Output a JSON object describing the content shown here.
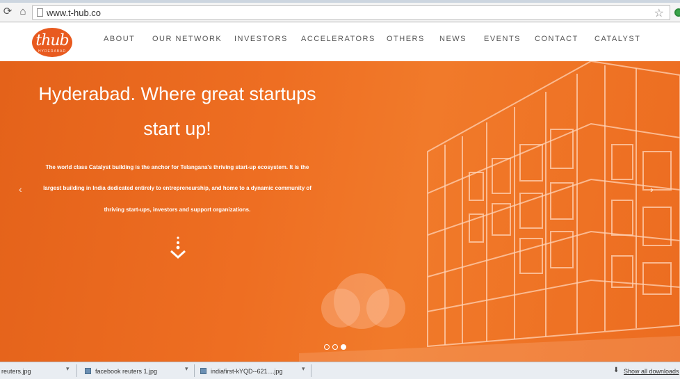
{
  "browser": {
    "url": "www.t-hub.co",
    "back_icon": "reload-icon",
    "home_icon": "home-icon"
  },
  "header": {
    "logo_text": "thub",
    "logo_sub": "HYDERABAD",
    "nav": [
      "ABOUT",
      "OUR NETWORK",
      "INVESTORS",
      "ACCELERATORS",
      "OTHERS",
      "NEWS",
      "EVENTS",
      "CONTACT",
      "CATALYST"
    ]
  },
  "hero": {
    "headline_line1": "Hyderabad. Where great startups",
    "headline_line2": "start up!",
    "body_line1": "The world class Catalyst building is the anchor for Telangana's thriving start-up ecosystem. It is the",
    "body_line2": "largest building in India dedicated entirely to entrepreneurship, and home to a dynamic community of",
    "body_line3": "thriving start-ups, investors and support organizations.",
    "prev_arrow": "‹",
    "next_arrow": "›",
    "slides_total": 3,
    "active_slide": 3
  },
  "downloads": {
    "items": [
      "reuters.jpg",
      "facebook reuters 1.jpg",
      "indiafirst-kYQD--621....jpg"
    ],
    "show_all": "Show all downloads"
  },
  "colors": {
    "brand_orange": "#ec6c20",
    "logo": "#e85a1f"
  }
}
